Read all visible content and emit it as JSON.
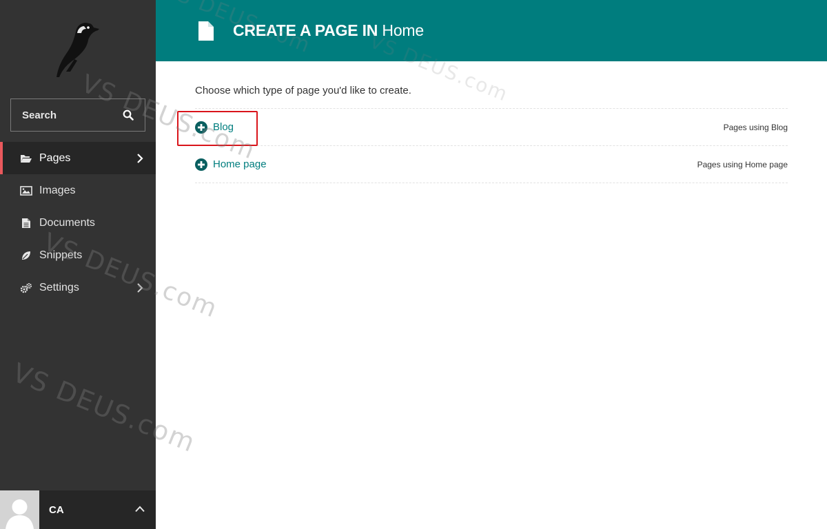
{
  "sidebar": {
    "search_label": "Search",
    "menu": [
      {
        "label": "Pages",
        "icon": "folder-open-icon",
        "active": true,
        "has_submenu": true
      },
      {
        "label": "Images",
        "icon": "image-icon",
        "active": false,
        "has_submenu": false
      },
      {
        "label": "Documents",
        "icon": "document-icon",
        "active": false,
        "has_submenu": false
      },
      {
        "label": "Snippets",
        "icon": "leaf-icon",
        "active": false,
        "has_submenu": false
      },
      {
        "label": "Settings",
        "icon": "cogs-icon",
        "active": false,
        "has_submenu": true
      }
    ],
    "account_initials": "CA"
  },
  "header": {
    "title": "CREATE A PAGE IN",
    "subtitle": "Home"
  },
  "main": {
    "intro": "Choose which type of page you'd like to create.",
    "page_types": [
      {
        "label": "Blog",
        "meta": "Pages using Blog"
      },
      {
        "label": "Home page",
        "meta": "Pages using Home page"
      }
    ]
  },
  "watermark": "VS DEUS.com",
  "colors": {
    "sidebar": "#333333",
    "header": "#007d7e",
    "accent": "#007d7e",
    "active_marker": "#e9585c",
    "highlight": "#d9141a"
  }
}
